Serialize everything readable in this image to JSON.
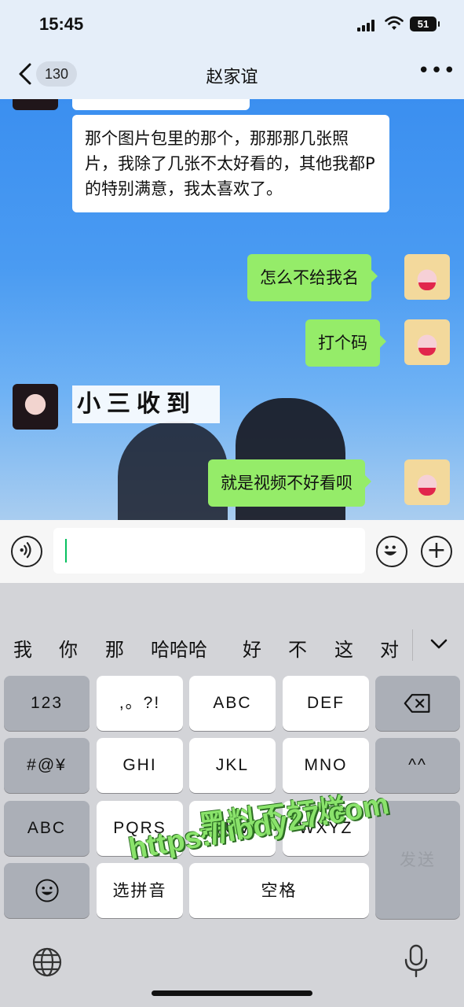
{
  "status_bar": {
    "time": "15:45",
    "battery": "51"
  },
  "header": {
    "unread_count": "130",
    "title": "赵家谊"
  },
  "messages": [
    {
      "side": "left",
      "text": "那个图片包里的那个，那那那几张照片，我除了几张不太好看的，其他我都P的特别满意，我太喜欢了。"
    },
    {
      "side": "right",
      "text": "怎么不给我名"
    },
    {
      "side": "right",
      "text": "打个码"
    },
    {
      "side": "left",
      "sticker": true,
      "text": "小三收到"
    },
    {
      "side": "right",
      "text": "就是视频不好看呗"
    }
  ],
  "input": {
    "value": ""
  },
  "keyboard": {
    "candidates": [
      "我",
      "你",
      "那",
      "哈哈哈",
      "好",
      "不",
      "这",
      "对"
    ],
    "rows": [
      [
        "123",
        ",。?!",
        "ABC",
        "DEF"
      ],
      [
        "#@¥",
        "GHI",
        "JKL",
        "MNO",
        "^^"
      ],
      [
        "ABC",
        "PQRS",
        "TUV",
        "WXYZ"
      ],
      [
        "选拼音",
        "空格"
      ]
    ],
    "send_label": "发送"
  },
  "watermark": {
    "line1": "黑料不打烊",
    "line2": "https://ibdy27.com"
  }
}
